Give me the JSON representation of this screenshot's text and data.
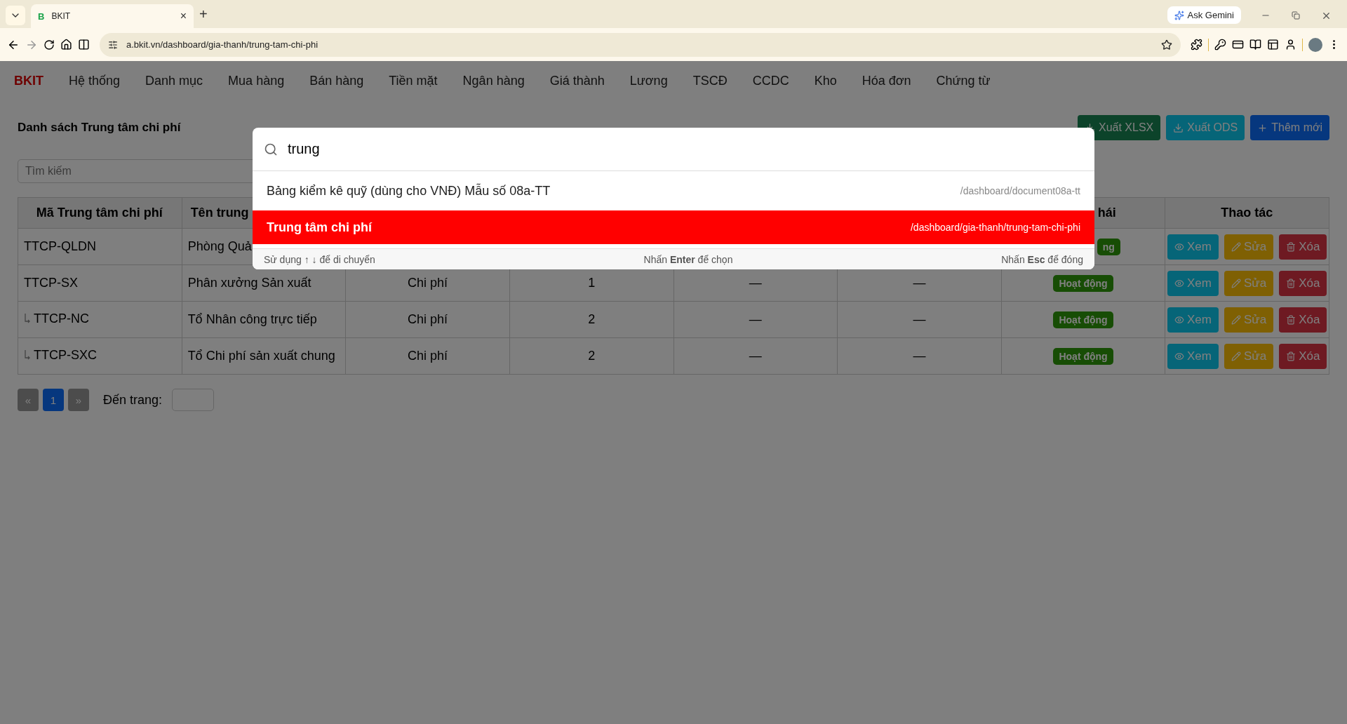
{
  "browser": {
    "tab": {
      "favicon": "B",
      "title": "BKIT",
      "close": "×"
    },
    "new_tab": "+",
    "gemini": "Ask Gemini",
    "url": "a.bkit.vn/dashboard/gia-thanh/trung-tam-chi-phi"
  },
  "nav": {
    "logo": "BKIT",
    "items": [
      {
        "label": "Hệ thống"
      },
      {
        "label": "Danh mục"
      },
      {
        "label": "Mua hàng"
      },
      {
        "label": "Bán hàng"
      },
      {
        "label": "Tiền mặt"
      },
      {
        "label": "Ngân hàng"
      },
      {
        "label": "Giá thành"
      },
      {
        "label": "Lương"
      },
      {
        "label": "TSCĐ"
      },
      {
        "label": "CCDC"
      },
      {
        "label": "Kho"
      },
      {
        "label": "Hóa đơn"
      },
      {
        "label": "Chứng từ"
      }
    ]
  },
  "page": {
    "title": "Danh sách Trung tâm chi phí",
    "search_placeholder": "Tìm kiếm",
    "buttons": [
      {
        "kind": "xlsx",
        "label": "Xuất XLSX"
      },
      {
        "kind": "ods",
        "label": "Xuất ODS"
      },
      {
        "kind": "add",
        "label": "Thêm mới"
      }
    ]
  },
  "table": {
    "columns": [
      "Mã Trung tâm chi phí",
      "Tên trung",
      "",
      "",
      "",
      "",
      "hái",
      "Thao tác"
    ],
    "rows": [
      {
        "code": "TTCP-QLDN",
        "name": "Phòng Quả",
        "status": "ng",
        "actions": [
          "Xem",
          "Sửa",
          "Xóa"
        ],
        "children": []
      },
      {
        "code": "TTCP-SX",
        "name": "Phân xưởng Sản xuất",
        "type": "Chi phí",
        "level_no": "1",
        "column_5": "—",
        "column_6": "—",
        "status": "Hoạt động",
        "actions": [
          "Xem",
          "Sửa",
          "Xóa"
        ],
        "children": [
          {
            "code": "TTCP-NC",
            "name": "Tổ Nhân công trực tiếp",
            "type": "Chi phí",
            "level_no": "2",
            "column_5": "—",
            "column_6": "—",
            "status": "Hoạt động",
            "actions": [
              "Xem",
              "Sửa",
              "Xóa"
            ]
          },
          {
            "code": "TTCP-SXC",
            "name": "Tổ Chi phí sản xuất chung",
            "type": "Chi phí",
            "level_no": "2",
            "column_5": "—",
            "column_6": "—",
            "status": "Hoạt động",
            "actions": [
              "Xem",
              "Sửa",
              "Xóa"
            ]
          }
        ]
      }
    ]
  },
  "pagination": {
    "prev": "«",
    "pages": [
      {
        "label": "1",
        "selected": true
      }
    ],
    "next": "»",
    "goto_label": "Đến trang:"
  },
  "palette": {
    "query": "trung",
    "results": [
      {
        "title": "Bảng kiểm kê quỹ (dùng cho VNĐ) Mẫu số 08a-TT",
        "path": "/dashboard/document08a-tt",
        "selected": false
      },
      {
        "title": "Trung tâm chi phí",
        "path": "/dashboard/gia-thanh/trung-tam-chi-phi",
        "selected": true
      }
    ],
    "hints": [
      "Sử dụng **↑ ↓** để di chuyển",
      "Nhấn **Enter** để chọn",
      "Nhấn **Esc** để đóng"
    ]
  }
}
